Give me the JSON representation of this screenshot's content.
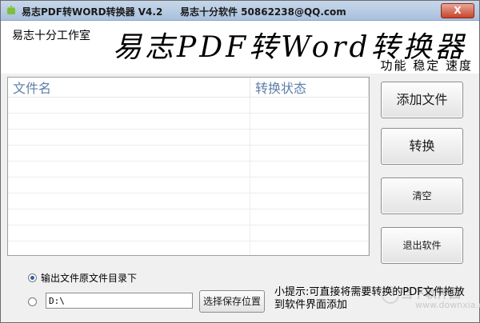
{
  "window": {
    "title": "易志PDF转WORD转换器 V4.2",
    "credit": "易志十分软件 50862238@QQ.com",
    "close_symbol": "X"
  },
  "banner": {
    "studio": "易志十分工作室",
    "headline": "易志PDF转Word转换器",
    "slogan": "功能 稳定 速度"
  },
  "file_table": {
    "columns": [
      "文件名",
      "转换状态"
    ],
    "rows": [
      [
        "",
        ""
      ],
      [
        "",
        ""
      ],
      [
        "",
        ""
      ],
      [
        "",
        ""
      ],
      [
        "",
        ""
      ],
      [
        "",
        ""
      ],
      [
        "",
        ""
      ],
      [
        "",
        ""
      ],
      [
        "",
        ""
      ],
      [
        "",
        ""
      ]
    ]
  },
  "actions": {
    "add_files": "添加文件",
    "convert": "转换",
    "clear": "清空",
    "exit": "退出软件"
  },
  "output": {
    "option_source_dir": "输出文件原文件目录下",
    "option_source_selected": true,
    "custom_path": "D:\\",
    "choose_location": "选择保存位置"
  },
  "tip": "小提示:可直接将需要转换的PDF文件拖放到软件界面添加",
  "watermark": {
    "name": "当下软件园",
    "url": "www.downxia.com"
  }
}
